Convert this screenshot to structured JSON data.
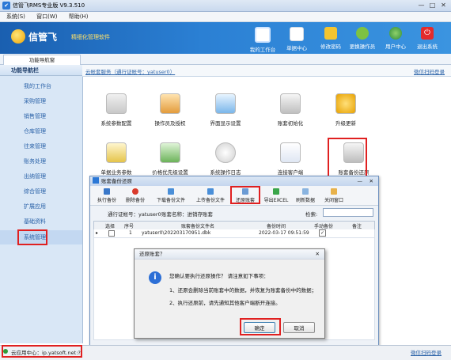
{
  "window": {
    "title": "信管飞RMS专业版 V9.3.510",
    "min": "—",
    "max": "□",
    "close": "✕"
  },
  "menubar": [
    "系统(S)",
    "窗口(W)",
    "帮助(H)"
  ],
  "banner": {
    "brand": "信管飞",
    "slogan": "精细化管理软件",
    "buttons": [
      "我的工作台",
      "单据中心",
      "修改密码",
      "更换操作员",
      "用户中心",
      "退出系统"
    ]
  },
  "tab": "功能导航窗",
  "sidebar": {
    "title": "功能导航栏",
    "items": [
      "我的工作台",
      "采购管理",
      "销售管理",
      "仓库管理",
      "往来管理",
      "账务处理",
      "出纳管理",
      "综合管理",
      "扩展应用",
      "基础资料",
      "系统管理"
    ]
  },
  "content": {
    "header_left": "云帐套服务（通行证帐号：yatuser0）",
    "header_right": "微信扫码登录",
    "icons": [
      "系统参数配置",
      "操作员及授权",
      "界面显示设置",
      "账套初始化",
      "升级更新",
      "单据业务参数",
      "价格优先级设置",
      "系统操作日志",
      "连接客户端",
      "账套备份还原"
    ]
  },
  "backup_window": {
    "title": "账套备份还原",
    "toolbar": [
      "执行备份",
      "删除备份",
      "下载备份文件",
      "上传备份文件",
      "还原账套",
      "导出EXCEL",
      "刷新数据",
      "关闭窗口"
    ],
    "info_left": "通行证帐号：yatuser0",
    "info_mid": "账套名称：进销存账套",
    "search_label": "检索:",
    "columns": [
      "选择",
      "序号",
      "账套备份文件名",
      "备份时间",
      "手动备份",
      "备注"
    ],
    "rows": [
      {
        "marker": "▸",
        "seq": "1",
        "file": "yatuser0\\202203170951.dbk",
        "time": "2022-03-17 09:51:59",
        "manual": "✓"
      }
    ]
  },
  "dialog": {
    "title": "还原账套？",
    "icon": "i",
    "message": "您确认要执行还原操作？ 请注意如下事项：",
    "note1": "1、还原会删除当前账套中的数据，并恢复为账套备份中的数据；",
    "note2": "2、执行还原前，请先通知其他客户端断开连接。",
    "ok": "确定",
    "cancel": "取消"
  },
  "statusbar": {
    "left": "云应用中心：ip.yatsoft.net:?",
    "right": "微信扫码登录"
  },
  "colors": {
    "accent": "#2b80d4",
    "highlight": "#e02020"
  }
}
